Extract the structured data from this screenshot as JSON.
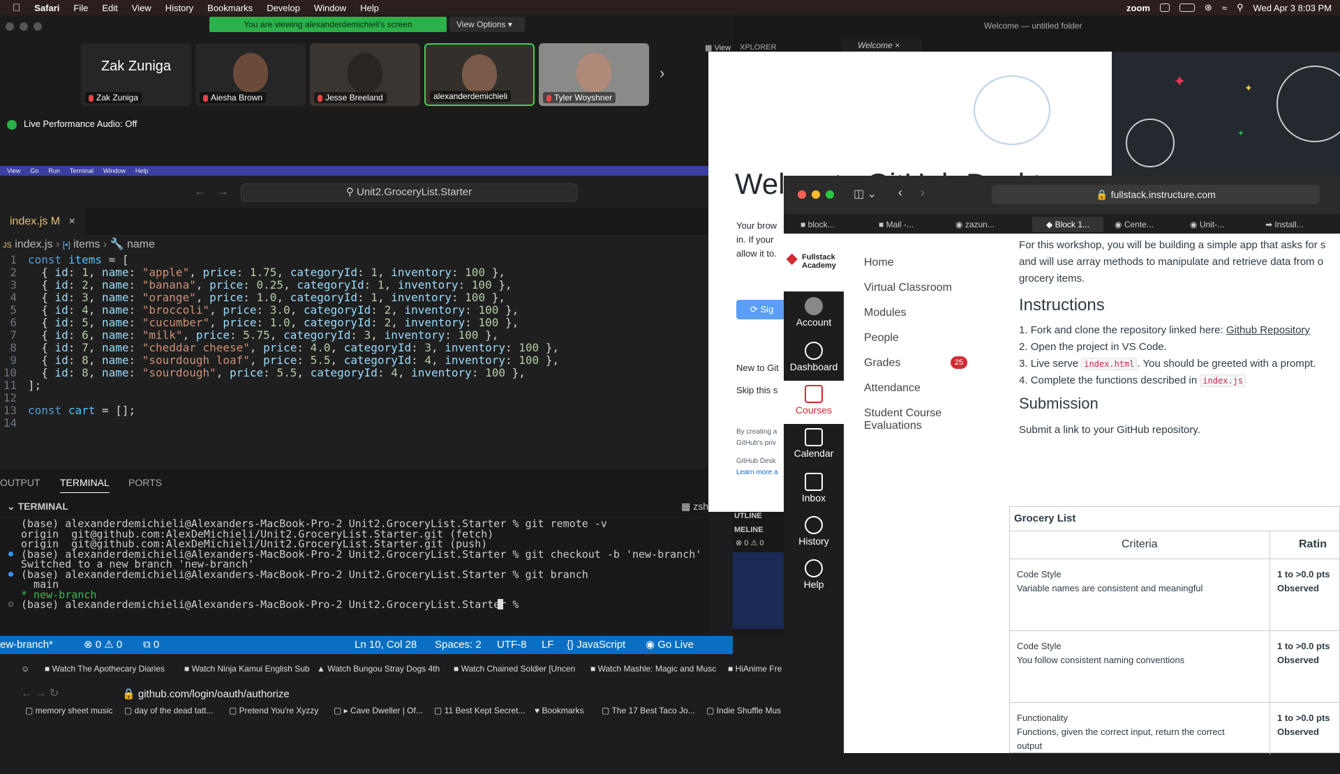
{
  "menubar": {
    "app": "Safari",
    "items": [
      "File",
      "Edit",
      "View",
      "History",
      "Bookmarks",
      "Develop",
      "Window",
      "Help"
    ],
    "zoom_label": "zoom",
    "datetime": "Wed Apr 3  8:03 PM"
  },
  "zoom": {
    "banner": "You are viewing alexanderdemichieli's screen",
    "view_options": "View Options",
    "participants": [
      {
        "name": "Zak Zuniga",
        "display": "Zak Zuniga"
      },
      {
        "name": "Aiesha Brown"
      },
      {
        "name": "Jesse Breeland"
      },
      {
        "name": "alexanderdemichieli"
      },
      {
        "name": "Tyler Woyshner"
      }
    ],
    "live_audio": "Live Performance Audio: Off",
    "view_label": "View"
  },
  "vscode": {
    "menu": [
      "View",
      "Go",
      "Run",
      "Terminal",
      "Window",
      "Help"
    ],
    "window_title": "Welcome — untitled folder",
    "search": "Unit2.GroceryList.Starter",
    "tab": {
      "name": "index.js",
      "badge": "M"
    },
    "other_tabs": [
      "XPLORER",
      "Welcome"
    ],
    "breadcrumb": {
      "file": "index.js",
      "symbol1": "items",
      "symbol2": "name"
    },
    "code": [
      {
        "n": "1",
        "text": "const items = ["
      },
      {
        "n": "2",
        "text": "  { id: 1, name: \"apple\", price: 1.75, categoryId: 1, inventory: 100 },"
      },
      {
        "n": "3",
        "text": "  { id: 2, name: \"banana\", price: 0.25, categoryId: 1, inventory: 100 },"
      },
      {
        "n": "4",
        "text": "  { id: 3, name: \"orange\", price: 1.0, categoryId: 1, inventory: 100 },"
      },
      {
        "n": "5",
        "text": "  { id: 4, name: \"broccoli\", price: 3.0, categoryId: 2, inventory: 100 },"
      },
      {
        "n": "6",
        "text": "  { id: 5, name: \"cucumber\", price: 1.0, categoryId: 2, inventory: 100 },"
      },
      {
        "n": "7",
        "text": "  { id: 6, name: \"milk\", price: 5.75, categoryId: 3, inventory: 100 },"
      },
      {
        "n": "8",
        "text": "  { id: 7, name: \"cheddar cheese\", price: 4.0, categoryId: 3, inventory: 100 },"
      },
      {
        "n": "9",
        "text": "  { id: 8, name: \"sourdough loaf\", price: 5.5, categoryId: 4, inventory: 100 },"
      },
      {
        "n": "10",
        "text": "  { id: 8, name: \"sourdough\", price: 5.5, categoryId: 4, inventory: 100 },"
      },
      {
        "n": "11",
        "text": "];"
      },
      {
        "n": "12",
        "text": ""
      },
      {
        "n": "13",
        "text": "const cart = [];"
      },
      {
        "n": "14",
        "text": ""
      }
    ],
    "panel_tabs": [
      "OUTPUT",
      "TERMINAL",
      "PORTS"
    ],
    "terminal_header": "TERMINAL",
    "shell": "zsh",
    "terminal": [
      "(base) alexanderdemichieli@Alexanders-MacBook-Pro-2 Unit2.GroceryList.Starter % git remote -v",
      "origin  git@github.com:AlexDeMichieli/Unit2.GroceryList.Starter.git (fetch)",
      "origin  git@github.com:AlexDeMichieli/Unit2.GroceryList.Starter.git (push)",
      "(base) alexanderdemichieli@Alexanders-MacBook-Pro-2 Unit2.GroceryList.Starter % git checkout -b 'new-branch'",
      "Switched to a new branch 'new-branch'",
      "(base) alexanderdemichieli@Alexanders-MacBook-Pro-2 Unit2.GroceryList.Starter % git branch",
      "  main",
      "* new-branch",
      "(base) alexanderdemichieli@Alexanders-MacBook-Pro-2 Unit2.GroceryList.Starter % "
    ],
    "status": {
      "branch": "ew-branch*",
      "errors": "0",
      "warnings": "0",
      "ports": "0",
      "position": "Ln 10, Col 28",
      "spaces": "Spaces: 2",
      "encoding": "UTF-8",
      "eol": "LF",
      "language": "JavaScript",
      "golive": "Go Live"
    },
    "side_panel": {
      "outline": "UTLINE",
      "timeline": "MELINE",
      "c1": "0",
      "c2": "0"
    }
  },
  "chrome": {
    "tabs": [
      "Watch The Apothecary Diaries",
      "Watch Ninja Kamui English Sub",
      "Watch Bungou Stray Dogs 4th",
      "Watch Chained Soldier [Uncen",
      "Watch Mashle: Magic and Musc",
      "HiAnime Fre"
    ],
    "url": "github.com/login/oauth/authorize",
    "bookmarks": [
      "memory sheet music",
      "day of the dead tatt...",
      "Pretend You're Xyzzy",
      "▸ Cave Dweller | Of...",
      "11 Best Kept Secret...",
      "Bookmarks",
      "The 17 Best Taco Jo...",
      "Indie Shuffle Mus"
    ]
  },
  "github_desktop": {
    "title": "Wel",
    "title_rest": "to GitHub Deskt",
    "text1": "Your brow",
    "text2": "in. If your",
    "text3": "allow it to.",
    "sign_in": "Sig",
    "new_to": "New to Git",
    "skip": "Skip this s",
    "fine1": "By creating a",
    "fine2": "GitHub's priv",
    "fine3": "GitHub Desk",
    "learn": "Learn more a"
  },
  "safari": {
    "url": "fullstack.instructure.com",
    "tabs": [
      "block...",
      "Mail -...",
      "zazun...",
      "Block 1...",
      "Cente...",
      "Unit-...",
      "Install..."
    ],
    "brand": {
      "line1": "Fullstack",
      "line2": "Academy"
    },
    "global_nav": [
      "Account",
      "Dashboard",
      "Courses",
      "Calendar",
      "Inbox",
      "History",
      "Help"
    ],
    "course_nav": [
      "Home",
      "Virtual Classroom",
      "Modules",
      "People",
      "Grades",
      "Attendance",
      "Student Course",
      "Evaluations"
    ],
    "grades_badge": "25",
    "intro1": "For this workshop, you will be building a simple app that asks for s",
    "intro2": "and will use array methods to manipulate and retrieve data from o",
    "intro3": "grocery items.",
    "instructions_heading": "Instructions",
    "steps": [
      {
        "n": "1.",
        "pre": "Fork and clone the repository linked here: ",
        "link": "Github Repository"
      },
      {
        "n": "2.",
        "pre": "Open the project in VS Code."
      },
      {
        "n": "3.",
        "pre": "Live serve ",
        "code": "index.html",
        "post": ". You should be greeted with a prompt."
      },
      {
        "n": "4.",
        "pre": "Complete the functions described in ",
        "code": "index.js"
      }
    ],
    "submission_heading": "Submission",
    "submission_text": "Submit a link to your GitHub repository.",
    "rubric": {
      "title": "Grocery List",
      "col1": "Criteria",
      "col2": "Ratin",
      "rows": [
        {
          "title": "Code Style",
          "desc": "Variable names are consistent and meaningful",
          "desc2": "",
          "pts": "1 to >0.0 pts",
          "rating": "Observed"
        },
        {
          "title": "Code Style",
          "desc": "You follow consistent naming conventions",
          "desc2": "",
          "pts": "1 to >0.0 pts",
          "rating": "Observed"
        },
        {
          "title": "Functionality",
          "desc": "Functions, given the correct input, return the correct",
          "desc2": "output",
          "pts": "1 to >0.0 pts",
          "rating": "Observed"
        }
      ]
    }
  }
}
